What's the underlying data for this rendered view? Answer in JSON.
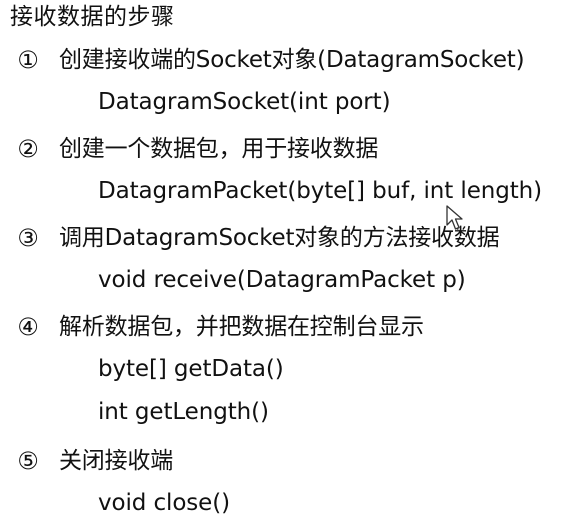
{
  "title": "接收数据的步骤",
  "steps": [
    {
      "number": "①",
      "text": "创建接收端的Socket对象(DatagramSocket)",
      "code": [
        "DatagramSocket(int port)"
      ]
    },
    {
      "number": "②",
      "text": "创建一个数据包，用于接收数据",
      "code": [
        "DatagramPacket(byte[] buf, int length)"
      ]
    },
    {
      "number": "③",
      "text": "调用DatagramSocket对象的方法接收数据",
      "code": [
        "void receive(DatagramPacket p)"
      ]
    },
    {
      "number": "④",
      "text": "解析数据包，并把数据在控制台显示",
      "code": [
        "byte[] getData()",
        "int getLength()"
      ]
    },
    {
      "number": "⑤",
      "text": "关闭接收端",
      "code": [
        "void close()"
      ]
    }
  ],
  "cursor_icon": "mouse-pointer-icon"
}
